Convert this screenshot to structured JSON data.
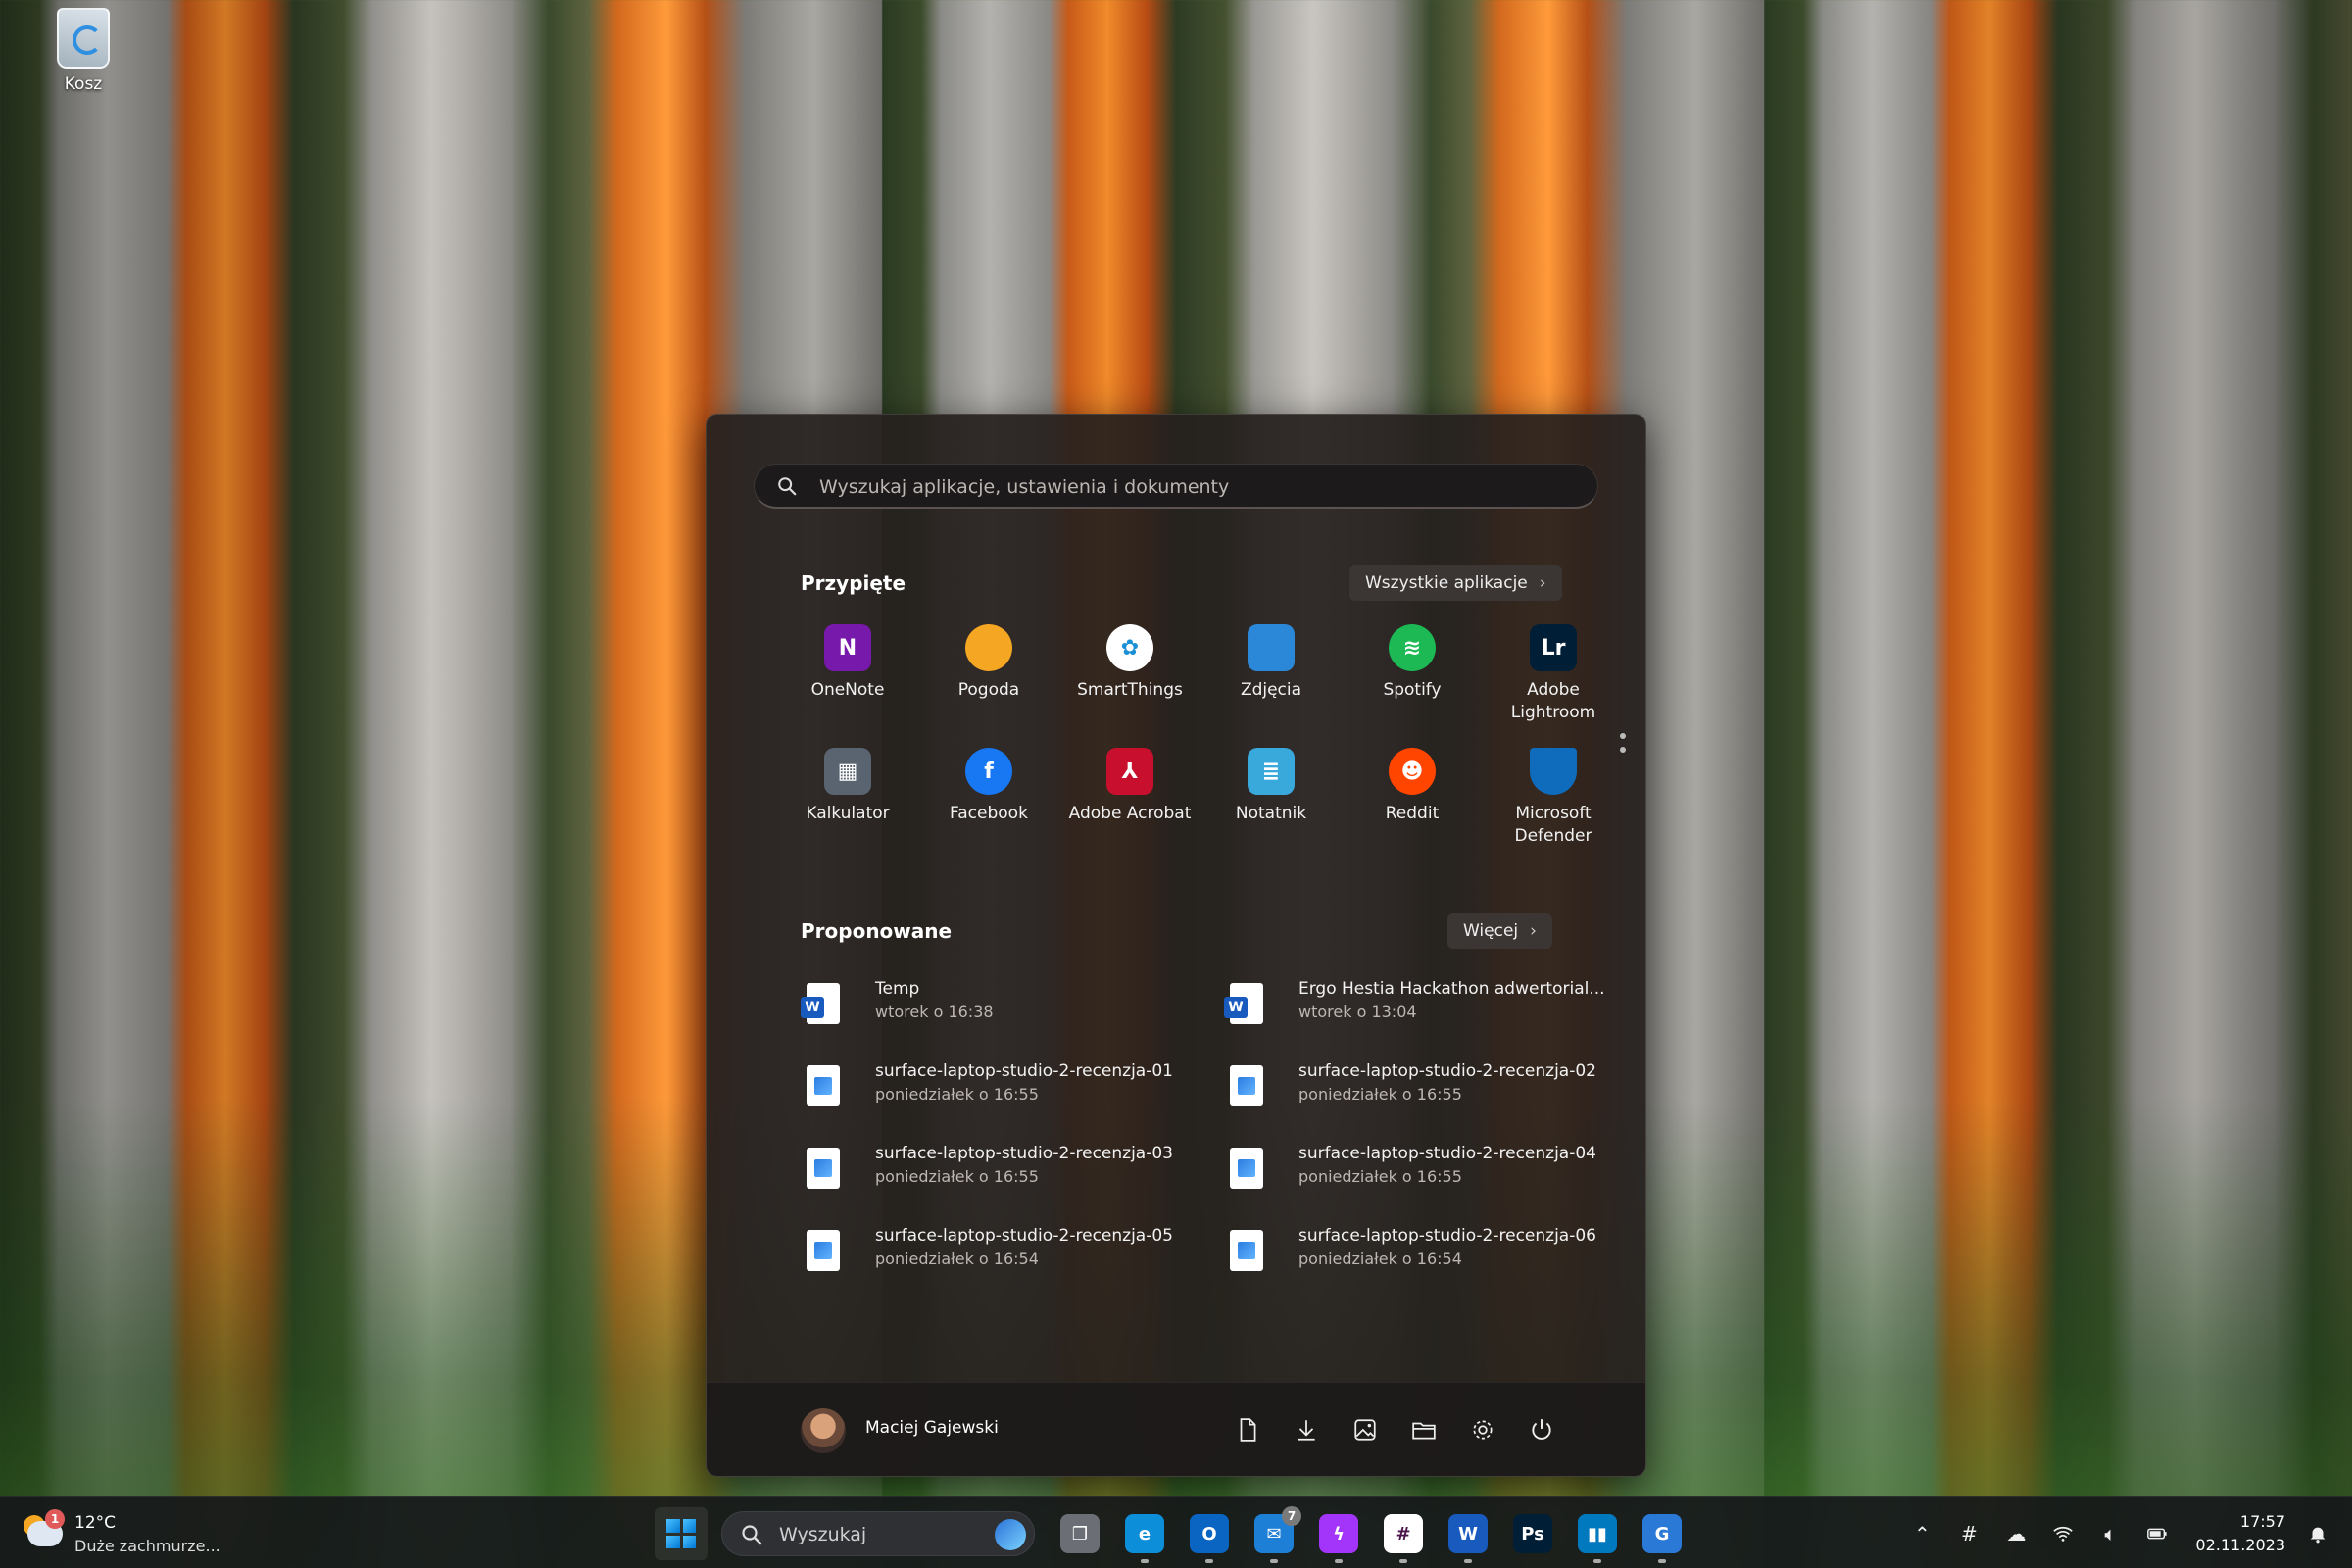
{
  "desktop": {
    "recycle_bin_label": "Kosz"
  },
  "start_menu": {
    "search_placeholder": "Wyszukaj aplikacje, ustawienia i dokumenty",
    "pinned_title": "Przypięte",
    "all_apps_label": "Wszystkie aplikacje",
    "pinned": [
      {
        "label": "OneNote",
        "icon": "onenote-icon",
        "color": "#7719aa",
        "glyph": "N"
      },
      {
        "label": "Pogoda",
        "icon": "weather-icon",
        "color": "#f5a623",
        "glyph": ""
      },
      {
        "label": "SmartThings",
        "icon": "smartthings-icon",
        "color": "#ffffff",
        "glyph": "✿"
      },
      {
        "label": "Zdjęcia",
        "icon": "photos-icon",
        "color": "#2b88d8",
        "glyph": ""
      },
      {
        "label": "Spotify",
        "icon": "spotify-icon",
        "color": "#1db954",
        "glyph": "≋"
      },
      {
        "label": "Adobe Lightroom",
        "icon": "lightroom-icon",
        "color": "#001e36",
        "glyph": "Lr"
      },
      {
        "label": "Kalkulator",
        "icon": "calculator-icon",
        "color": "#5a6470",
        "glyph": "▦"
      },
      {
        "label": "Facebook",
        "icon": "facebook-icon",
        "color": "#1877f2",
        "glyph": "f"
      },
      {
        "label": "Adobe Acrobat",
        "icon": "acrobat-icon",
        "color": "#c8102e",
        "glyph": "⅄"
      },
      {
        "label": "Notatnik",
        "icon": "notepad-icon",
        "color": "#39a9dc",
        "glyph": "≣"
      },
      {
        "label": "Reddit",
        "icon": "reddit-icon",
        "color": "#ff4500",
        "glyph": "☻"
      },
      {
        "label": "Microsoft Defender",
        "icon": "defender-icon",
        "color": "#0f6cbd",
        "glyph": ""
      }
    ],
    "recommended_title": "Proponowane",
    "more_label": "Więcej",
    "recommended": [
      {
        "name": "Temp",
        "time": "wtorek o 16:38",
        "type": "word"
      },
      {
        "name": "Ergo Hestia Hackathon adwertorial...",
        "time": "wtorek o 13:04",
        "type": "word"
      },
      {
        "name": "surface-laptop-studio-2-recenzja-01",
        "time": "poniedziałek o 16:55",
        "type": "img"
      },
      {
        "name": "surface-laptop-studio-2-recenzja-02",
        "time": "poniedziałek o 16:55",
        "type": "img"
      },
      {
        "name": "surface-laptop-studio-2-recenzja-03",
        "time": "poniedziałek o 16:55",
        "type": "img"
      },
      {
        "name": "surface-laptop-studio-2-recenzja-04",
        "time": "poniedziałek o 16:55",
        "type": "img"
      },
      {
        "name": "surface-laptop-studio-2-recenzja-05",
        "time": "poniedziałek o 16:54",
        "type": "img"
      },
      {
        "name": "surface-laptop-studio-2-recenzja-06",
        "time": "poniedziałek o 16:54",
        "type": "img"
      }
    ],
    "user_name": "Maciej Gajewski",
    "footer_icons": [
      "documents-icon",
      "downloads-icon",
      "pictures-icon",
      "file-explorer-icon",
      "settings-icon",
      "power-icon"
    ]
  },
  "taskbar": {
    "weather_temp": "12°C",
    "weather_desc": "Duże zachmurze...",
    "weather_badge": "1",
    "search_label": "Wyszukaj",
    "apps": [
      {
        "name": "task-view-icon",
        "color": "#6b6f75",
        "glyph": "❐",
        "running": false
      },
      {
        "name": "edge-icon",
        "color": "#0c8ed9",
        "glyph": "e",
        "running": true
      },
      {
        "name": "outlook-new-icon",
        "color": "#0a64c2",
        "glyph": "O",
        "running": true
      },
      {
        "name": "mail-icon",
        "color": "#1d7fd6",
        "glyph": "✉",
        "running": true,
        "count": "7"
      },
      {
        "name": "messenger-icon",
        "color": "#a334fa",
        "glyph": "ϟ",
        "running": true
      },
      {
        "name": "slack-icon",
        "color": "#ffffff",
        "glyph": "#",
        "running": true
      },
      {
        "name": "word-icon",
        "color": "#185abd",
        "glyph": "W",
        "running": true
      },
      {
        "name": "photoshop-icon",
        "color": "#001e36",
        "glyph": "Ps",
        "running": false
      },
      {
        "name": "trello-icon",
        "color": "#0079bf",
        "glyph": "▮▮",
        "running": true
      },
      {
        "name": "translator-icon",
        "color": "#2b79d6",
        "glyph": "G",
        "running": true
      }
    ],
    "time": "17:57",
    "date": "02.11.2023"
  }
}
